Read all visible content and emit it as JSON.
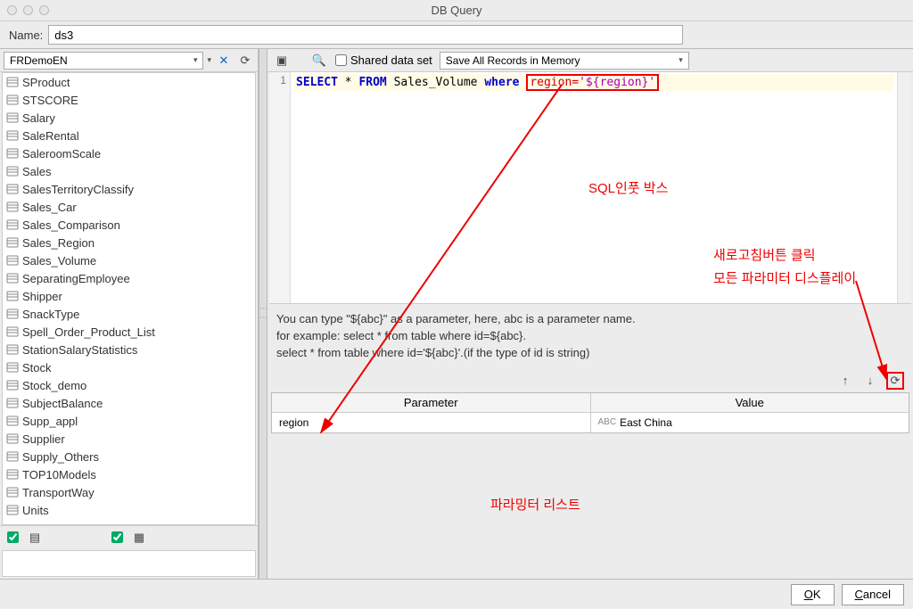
{
  "window_title": "DB Query",
  "name_label": "Name:",
  "name_value": "ds3",
  "db_name": "FRDemoEN",
  "tables": [
    "SProduct",
    "STSCORE",
    "Salary",
    "SaleRental",
    "SaleroomScale",
    "Sales",
    "SalesTerritoryClassify",
    "Sales_Car",
    "Sales_Comparison",
    "Sales_Region",
    "Sales_Volume",
    "SeparatingEmployee",
    "Shipper",
    "SnackType",
    "Spell_Order_Product_List",
    "StationSalaryStatistics",
    "Stock",
    "Stock_demo",
    "SubjectBalance",
    "Supp_appl",
    "Supplier",
    "Supply_Others",
    "TOP10Models",
    "TransportWay",
    "Units"
  ],
  "shared_label": "Shared data set",
  "save_option": "Save All Records in Memory",
  "sql_line_no": "1",
  "sql": {
    "select": "SELECT",
    "star": "*",
    "from": "FROM",
    "table": "Sales_Volume",
    "where": "where",
    "cond": "region='${region}'"
  },
  "hint1": "You can type \"${abc}\" as a parameter, here, abc is a parameter name.",
  "hint2": "for example: select * from table where id=${abc}.",
  "hint3": "select * from table where id='${abc}'.(if the type of id is string)",
  "param_headers": {
    "p": "Parameter",
    "v": "Value"
  },
  "param_row": {
    "name": "region",
    "value": "East China"
  },
  "annotations": {
    "sql_box": "SQL인풋 박스",
    "refresh": "새로고침버튼 클릭",
    "all_params": "모든 파라미터 디스플레이",
    "param_list": "파라밍터 리스트"
  },
  "buttons": {
    "ok": "OK",
    "cancel": "Cancel"
  }
}
